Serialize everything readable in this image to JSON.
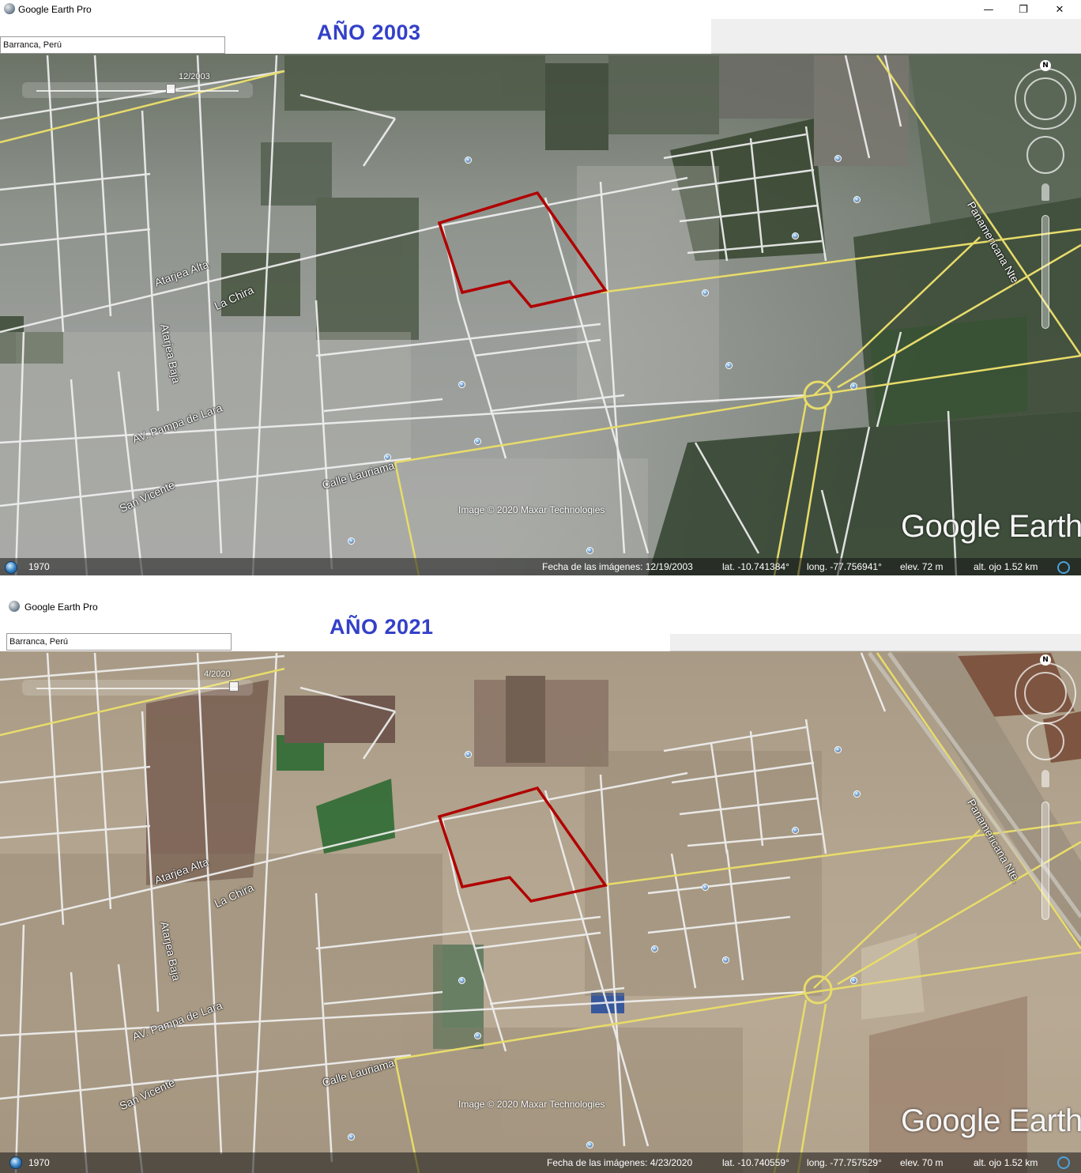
{
  "screens": [
    {
      "app_title": "Google Earth Pro",
      "search_value": "Barranca, Perú",
      "year_heading": "AÑO 2003",
      "time_slider_date": "12/2003",
      "streets": {
        "atarjea_alta": "Atarjea Alta",
        "la_chira": "La Chira",
        "atarjea_baja": "Atarjea Baja",
        "pampa_de_lara": "AV. Pampa de Lara",
        "san_vicente": "San Vicente",
        "calle_lauriama": "Calle Lauriama",
        "panamericana": "Panamericana Nte."
      },
      "copyright": "Image © 2020 Maxar Technologies",
      "logo": "Google Earth",
      "status": {
        "historical_year": "1970",
        "imagery_date": "Fecha de las imágenes: 12/19/2003",
        "lat": "lat.  -10.741384°",
        "lon": "long.  -77.756941°",
        "elev": "elev.    72 m",
        "eye_alt": "alt. ojo   1.52 km"
      }
    },
    {
      "app_title": "Google Earth Pro",
      "search_value": "Barranca, Perú",
      "year_heading": "AÑO 2021",
      "time_slider_date": "4/2020",
      "streets": {
        "atarjea_alta": "Atarjea Alta",
        "la_chira": "La Chira",
        "atarjea_baja": "Atarjea Baja",
        "pampa_de_lara": "AV. Pampa de Lara",
        "san_vicente": "San Vicente",
        "calle_lauriama": "Calle Lauriama",
        "panamericana": "Panamericana Nte."
      },
      "copyright": "Image © 2020 Maxar Technologies",
      "logo": "Google Earth",
      "status": {
        "historical_year": "1970",
        "imagery_date": "Fecha de las imágenes: 4/23/2020",
        "lat": "lat.  -10.740559°",
        "lon": "long.  -77.757529°",
        "elev": "elev.    70 m",
        "eye_alt": "alt. ojo   1.52 km"
      }
    }
  ],
  "window_controls": {
    "minimize": "—",
    "restore": "❐",
    "close": "✕"
  },
  "compass_letter": "N",
  "colors": {
    "year_heading": "#3340c9",
    "parcel_outline": "#b00000",
    "road_yellow": "#e8dc6a",
    "road_white": "#f2f2f2"
  }
}
